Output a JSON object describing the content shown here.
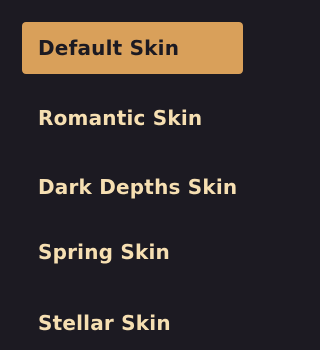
{
  "menu": {
    "items": [
      {
        "label": "Default Skin",
        "selected": true
      },
      {
        "label": "Romantic Skin",
        "selected": false
      },
      {
        "label": "Dark Depths Skin",
        "selected": false
      },
      {
        "label": "Spring Skin",
        "selected": false
      },
      {
        "label": "Stellar Skin",
        "selected": false
      }
    ]
  },
  "colors": {
    "background": "#1c1a22",
    "selected_background": "#d9a05a",
    "text": "#f6dfb2",
    "selected_text": "#1c1a22"
  }
}
